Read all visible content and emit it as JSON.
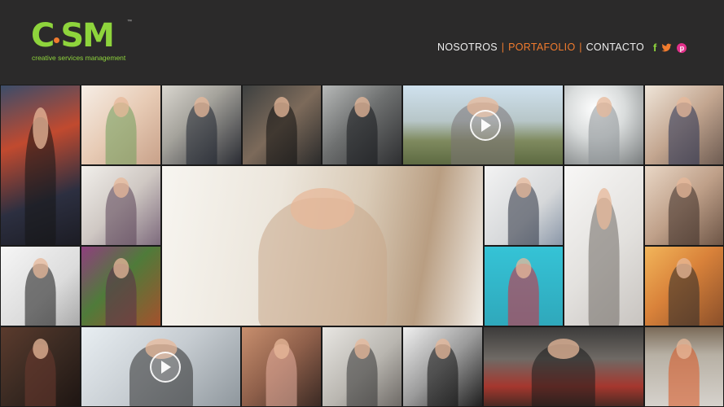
{
  "logo": {
    "text": "CSM",
    "tagline": "creative services management",
    "trademark": "™"
  },
  "nav": {
    "items": [
      "NOSOTROS",
      "PORTAFOLIO",
      "CONTACTO"
    ],
    "separator": "|",
    "active_index": 1
  },
  "social": {
    "icons": [
      "facebook-icon",
      "twitter-icon",
      "pinterest-icon"
    ],
    "facebook_glyph": "f",
    "pinterest_glyph": "p"
  },
  "colors": {
    "background": "#2b2a2a",
    "brand_green": "#8ed43c",
    "accent_orange": "#f07b2e",
    "pinterest": "#e2308a",
    "nav_text": "#eeeeee"
  },
  "gallery": {
    "tiles": [
      {
        "name": "photo-city-street-model",
        "bg": "linear-gradient(160deg,#3b4d6a 0%,#c14a2f 35%,#2c2f40 70%,#1c1c24 100%)",
        "fig": "#151515"
      },
      {
        "name": "photo-jewelry-portrait",
        "bg": "linear-gradient(135deg,#f6eee6 0%,#e7cbb5 50%,#c8a189 100%)",
        "fig": "#6e9d5a"
      },
      {
        "name": "photo-man-knit-sweater",
        "bg": "linear-gradient(135deg,#d9d6cf 0%,#a5a39c 40%,#2a2c33 100%)",
        "fig": "#1f2430"
      },
      {
        "name": "photo-blonde-lingerie",
        "bg": "linear-gradient(135deg,#3d4040 0%,#7c6a5a 50%,#2b2b2b 100%)",
        "fig": "#101010"
      },
      {
        "name": "photo-man-suit-coat",
        "bg": "linear-gradient(135deg,#b7b9b8 0%,#6e7070 45%,#2e2f31 100%)",
        "fig": "#15171b"
      },
      {
        "name": "photo-fur-coat-car",
        "bg": "linear-gradient(180deg,#cfe1ee 0%,#b7c6c8 45%,#7f8a5f 70%,#5d6a42 100%)",
        "fig": "#7a7274"
      },
      {
        "name": "photo-silver-outfit",
        "bg": "radial-gradient(circle at 40% 30%,#ffffff 0%,#d9dcdc 40%,#777b7c 100%)",
        "fig": "#8d9296"
      },
      {
        "name": "photo-navy-dress-mannequins",
        "bg": "linear-gradient(135deg,#efe5d9 0%,#c3a690 50%,#6d5b51 100%)",
        "fig": "#243052"
      },
      {
        "name": "photo-purple-knit-model",
        "bg": "linear-gradient(135deg,#f1efeb 0%,#cfc8c3 50%,#7d6a7c 100%)",
        "fig": "#5a4255"
      },
      {
        "name": "photo-featured-portrait",
        "bg": "linear-gradient(100deg,#f7f5f0 0%,#ece6dc 35%,#d9cab6 60%,#b99e82 80%,#f2eee8 100%)",
        "fig": "#c9a88a"
      },
      {
        "name": "photo-photographer-dog",
        "bg": "linear-gradient(135deg,#f3f3f3 0%,#d6d8da 60%,#8a97a8 100%)",
        "fig": "#2c3240"
      },
      {
        "name": "photo-grey-gown",
        "bg": "linear-gradient(135deg,#f8f7f6 0%,#e3e1de 55%,#c8c4c0 100%)",
        "fig": "#6f6965"
      },
      {
        "name": "photo-lingerie-mirror",
        "bg": "linear-gradient(135deg,#e9d7c6 0%,#bfa089 50%,#6d5546 100%)",
        "fig": "#3a2b26"
      },
      {
        "name": "photo-floral-jacket",
        "bg": "linear-gradient(135deg,#f6f6f6 0%,#dcdcdc 60%,#a9a9a9 100%)",
        "fig": "#151515"
      },
      {
        "name": "photo-garden-dress",
        "bg": "linear-gradient(135deg,#8f3f7e 0%,#4f7b3a 45%,#a4512d 100%)",
        "fig": "#5b2d4d"
      },
      {
        "name": "photo-red-bra",
        "bg": "linear-gradient(180deg,#35c3d6 0%,#2fa8bb 100%)",
        "fig": "#d8263a"
      },
      {
        "name": "photo-autumn-model",
        "bg": "linear-gradient(135deg,#f2b55a 0%,#d9823a 45%,#8a4f2a 100%)",
        "fig": "#2a2a2a"
      },
      {
        "name": "photo-hat-closet",
        "bg": "linear-gradient(135deg,#5b3b2d 0%,#3a2a22 50%,#1e1512 100%)",
        "fig": "#6b3b2f"
      },
      {
        "name": "photo-black-lingerie-video",
        "bg": "linear-gradient(135deg,#e8eef2 0%,#c6ccd1 50%,#8f979d 100%)",
        "fig": "#2b2b2b"
      },
      {
        "name": "photo-lingerie-pair",
        "bg": "linear-gradient(135deg,#c88f6e 0%,#8e5f4a 50%,#3b2a24 100%)",
        "fig": "#e8b0a0"
      },
      {
        "name": "photo-man-cardigan",
        "bg": "linear-gradient(135deg,#e8e6e2 0%,#b9b6b0 55%,#6e6a66 100%)",
        "fig": "#343434"
      },
      {
        "name": "photo-woman-bw",
        "bg": "linear-gradient(135deg,#f0f0f0 0%,#9a9a9a 50%,#1f1f1f 100%)",
        "fig": "#111111"
      },
      {
        "name": "photo-cafe-signage",
        "bg": "linear-gradient(180deg,#3c3b3a 0%,#6f6a65 40%,#a5372e 75%,#4a2a23 100%)",
        "fig": "#1c1c1c"
      },
      {
        "name": "photo-umbrella-coat",
        "bg": "linear-gradient(180deg,#7a6a58 0%,#b7b0a4 35%,#d6d2cc 100%)",
        "fig": "#d9531f"
      }
    ]
  }
}
